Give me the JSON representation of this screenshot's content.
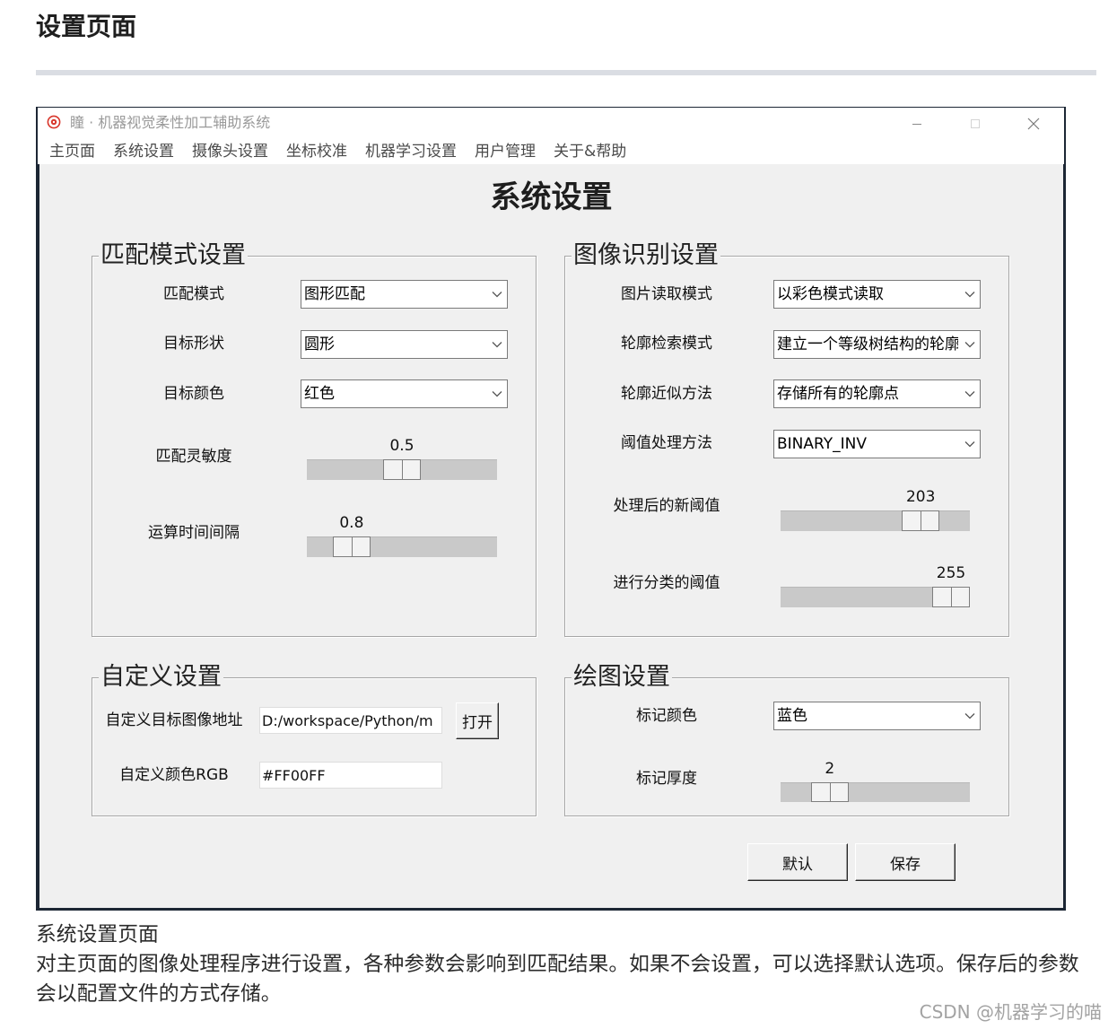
{
  "article": {
    "heading": "设置页面",
    "caption": "系统设置页面",
    "paragraph": "对主页面的图像处理程序进行设置，各种参数会影响到匹配结果。如果不会设置，可以选择默认选项。保存后的参数会以配置文件的方式存储。",
    "watermark": "CSDN @机器学习的喵"
  },
  "window": {
    "title": "瞳 · 机器视觉柔性加工辅助系统",
    "icon": "app-logo-icon",
    "controls": {
      "minimize": "minimize-icon",
      "maximize": "maximize-icon",
      "close": "close-icon"
    },
    "menu": [
      "主页面",
      "系统设置",
      "摄像头设置",
      "坐标校准",
      "机器学习设置",
      "用户管理",
      "关于&帮助"
    ],
    "page_title": "系统设置",
    "match_group": {
      "title": "匹配模式设置",
      "match_mode": {
        "label": "匹配模式",
        "value": "图形匹配"
      },
      "target_shape": {
        "label": "目标形状",
        "value": "圆形"
      },
      "target_color": {
        "label": "目标颜色",
        "value": "红色"
      },
      "sensitivity": {
        "label": "匹配灵敏度",
        "value": "0.5",
        "level": 0.5
      },
      "interval": {
        "label": "运算时间间隔",
        "value": "0.8",
        "level": 0.17
      }
    },
    "recognition_group": {
      "title": "图像识别设置",
      "read_mode": {
        "label": "图片读取模式",
        "value": "以彩色模式读取"
      },
      "contour_retrieval": {
        "label": "轮廓检索模式",
        "value": "建立一个等级树结构的轮廓"
      },
      "contour_approx": {
        "label": "轮廓近似方法",
        "value": "存储所有的轮廓点"
      },
      "threshold_method": {
        "label": "阈值处理方法",
        "value": "BINARY_INV"
      },
      "new_threshold": {
        "label": "处理后的新阈值",
        "value": "203",
        "level": 0.8
      },
      "classify_threshold": {
        "label": "进行分类的阈值",
        "value": "255",
        "level": 1.0
      }
    },
    "custom_group": {
      "title": "自定义设置",
      "image_path": {
        "label": "自定义目标图像地址",
        "value": "D:/workspace/Python/m",
        "button": "打开"
      },
      "color_rgb": {
        "label": "自定义颜色RGB",
        "value": "#FF00FF"
      }
    },
    "draw_group": {
      "title": "绘图设置",
      "mark_color": {
        "label": "标记颜色",
        "value": "蓝色"
      },
      "mark_thickness": {
        "label": "标记厚度",
        "value": "2",
        "level": 0.2
      }
    },
    "buttons": {
      "default": "默认",
      "save": "保存"
    }
  },
  "colors": {
    "app_icon": "#d8352a",
    "dialog_background": "#f0f0f0"
  }
}
